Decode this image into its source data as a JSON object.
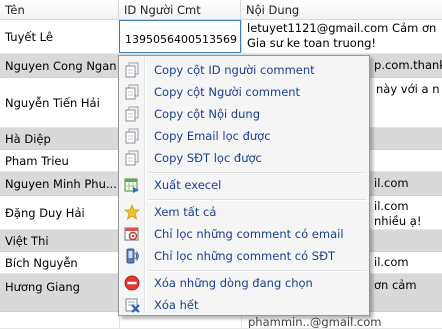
{
  "columns": [
    "Tên",
    "ID Người Cmt",
    "Nội Dung"
  ],
  "rows": [
    {
      "name": "Tuyết Lê",
      "id": "1395056400513569",
      "content": "letuyet1121@gmail.com Cảm ơn Gia sư ke toan truong!",
      "grey": false,
      "selected": true
    },
    {
      "name": "Nguyen Cong Ngan",
      "id": "",
      "content": "p.com.thanks",
      "grey": true
    },
    {
      "name": "Nguyễn Tiến Hải",
      "id": "",
      "content": "này với a n",
      "grey": false
    },
    {
      "name": "Hà Diệp",
      "id": "",
      "content": "",
      "grey": true
    },
    {
      "name": "Pham Trieu",
      "id": "",
      "content": "",
      "grey": false
    },
    {
      "name": "Nguyen Minh Phu...",
      "id": "",
      "content": "il.com",
      "grey": true
    },
    {
      "name": "Đặng Duy Hải",
      "id": "",
      "content": "il.com nhiều ạ!",
      "grey": false
    },
    {
      "name": "Việt Thi",
      "id": "",
      "content": "",
      "grey": true
    },
    {
      "name": "Bích Nguyễn",
      "id": "",
      "content": "il.com",
      "grey": false
    },
    {
      "name": "Hương Giang",
      "id": "",
      "content": "ơn cảm",
      "grey": true
    },
    {
      "name": "",
      "id": "",
      "content": "phammin..@gmail.com",
      "grey": false
    }
  ],
  "menu": {
    "items": [
      {
        "label": "Copy cột ID người comment",
        "icon": "copy-icon"
      },
      {
        "label": "Copy cột Người comment",
        "icon": "copy-icon"
      },
      {
        "label": "Copy cột Nội dung",
        "icon": "copy-icon"
      },
      {
        "label": "Copy Email lọc được",
        "icon": "copy-icon"
      },
      {
        "label": "Copy SĐT lọc được",
        "icon": "copy-icon"
      },
      {
        "label": "Xuất execel",
        "icon": "excel-export-icon"
      },
      {
        "label": "Xem tất cả",
        "icon": "star-icon"
      },
      {
        "label": "Chỉ lọc những comment có email",
        "icon": "email-filter-icon"
      },
      {
        "label": "Chỉ lọc những comment có SĐT",
        "icon": "phone-filter-icon"
      },
      {
        "label": "Xóa những dòng đang chọn",
        "icon": "delete-selected-icon"
      },
      {
        "label": "Xóa hết",
        "icon": "clear-all-icon"
      }
    ]
  },
  "colors": {
    "grey_row": "#d9d9d9",
    "menu_text": "#1a3f8a",
    "selection_border": "#3c7fb1"
  }
}
